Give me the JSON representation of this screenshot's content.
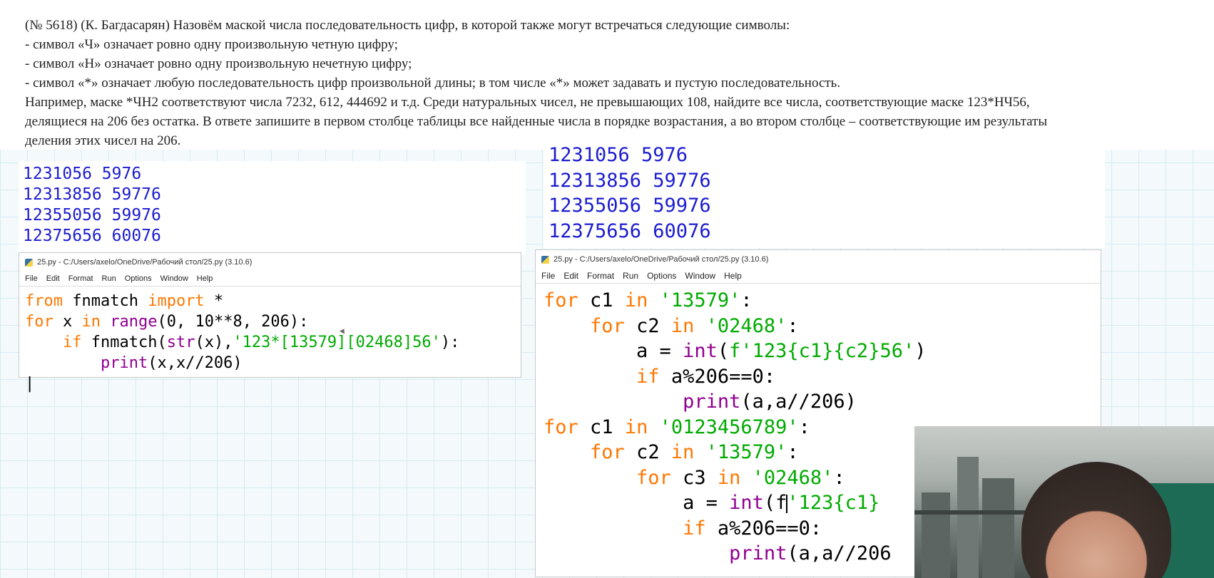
{
  "task": {
    "lines": [
      "(№ 5618) (К. Багдасарян) Назовём маской числа последовательность цифр, в которой также могут встречаться следующие символы:",
      "- символ «Ч» означает ровно одну произвольную четную цифру;",
      "- символ «Н» означает ровно одну произвольную нечетную цифру;",
      "- символ «*» означает любую последовательность цифр произвольной длины; в том числе «*» может задавать и пустую последовательность.",
      "Например, маске *ЧН2 соответствуют числа 7232, 612, 444692 и т.д. Среди натуральных чисел, не превышающих 108, найдите все числа, соответствующие маске 123*НЧ56,",
      "делящиеся на 206 без остатка. В ответе запишите в первом столбце таблицы все найденные числа в порядке возрастания, а во втором столбце – соответствующие им результаты",
      "деления этих чисел на 206."
    ]
  },
  "output_left": [
    "1231056 5976",
    "12313856 59776",
    "12355056 59976",
    "12375656 60076"
  ],
  "output_right": [
    "1231056 5976",
    "12313856 59776",
    "12355056 59976",
    "12375656 60076"
  ],
  "editor_left": {
    "title": "25.py - C:/Users/axelo/OneDrive/Рабочий стол/25.py (3.10.6)",
    "menu": [
      "File",
      "Edit",
      "Format",
      "Run",
      "Options",
      "Window",
      "Help"
    ],
    "code": [
      [
        {
          "t": "from",
          "c": "kw"
        },
        {
          "t": " fnmatch "
        },
        {
          "t": "import",
          "c": "kw"
        },
        {
          "t": " *"
        }
      ],
      [
        {
          "t": "for",
          "c": "kw"
        },
        {
          "t": " x "
        },
        {
          "t": "in",
          "c": "kw"
        },
        {
          "t": " "
        },
        {
          "t": "range",
          "c": "bi"
        },
        {
          "t": "(0, 10**8, 206):"
        }
      ],
      [
        {
          "t": "    "
        },
        {
          "t": "if",
          "c": "kw"
        },
        {
          "t": " fnmatch("
        },
        {
          "t": "str",
          "c": "bi"
        },
        {
          "t": "(x),"
        },
        {
          "t": "'123*[13579][02468]56'",
          "c": "st"
        },
        {
          "t": "):"
        }
      ],
      [
        {
          "t": "        "
        },
        {
          "t": "print",
          "c": "bi"
        },
        {
          "t": "(x,x//206)"
        }
      ],
      [
        {
          "t": "|"
        }
      ]
    ]
  },
  "editor_right": {
    "title": "25.py - C:/Users/axelo/OneDrive/Рабочий стол/25.py (3.10.6)",
    "menu": [
      "File",
      "Edit",
      "Format",
      "Run",
      "Options",
      "Window",
      "Help"
    ],
    "code": [
      [
        {
          "t": "for",
          "c": "kw"
        },
        {
          "t": " c1 "
        },
        {
          "t": "in",
          "c": "kw"
        },
        {
          "t": " "
        },
        {
          "t": "'13579'",
          "c": "st"
        },
        {
          "t": ":"
        }
      ],
      [
        {
          "t": "    "
        },
        {
          "t": "for",
          "c": "kw"
        },
        {
          "t": " c2 "
        },
        {
          "t": "in",
          "c": "kw"
        },
        {
          "t": " "
        },
        {
          "t": "'02468'",
          "c": "st"
        },
        {
          "t": ":"
        }
      ],
      [
        {
          "t": "        a = "
        },
        {
          "t": "int",
          "c": "bi"
        },
        {
          "t": "("
        },
        {
          "t": "f'123{c1}{c2}56'",
          "c": "st"
        },
        {
          "t": ")"
        }
      ],
      [
        {
          "t": "        "
        },
        {
          "t": "if",
          "c": "kw"
        },
        {
          "t": " a%206==0:"
        }
      ],
      [
        {
          "t": "            "
        },
        {
          "t": "print",
          "c": "bi"
        },
        {
          "t": "(a,a//206)"
        }
      ],
      [
        {
          "t": "for",
          "c": "kw"
        },
        {
          "t": " c1 "
        },
        {
          "t": "in",
          "c": "kw"
        },
        {
          "t": " "
        },
        {
          "t": "'0123456789'",
          "c": "st"
        },
        {
          "t": ":"
        }
      ],
      [
        {
          "t": "    "
        },
        {
          "t": "for",
          "c": "kw"
        },
        {
          "t": " c2 "
        },
        {
          "t": "in",
          "c": "kw"
        },
        {
          "t": " "
        },
        {
          "t": "'13579'",
          "c": "st"
        },
        {
          "t": ":"
        }
      ],
      [
        {
          "t": "        "
        },
        {
          "t": "for",
          "c": "kw"
        },
        {
          "t": " c3 "
        },
        {
          "t": "in",
          "c": "kw"
        },
        {
          "t": " "
        },
        {
          "t": "'02468'",
          "c": "st"
        },
        {
          "t": ":"
        }
      ],
      [
        {
          "t": "            a = "
        },
        {
          "t": "int",
          "c": "bi"
        },
        {
          "t": "(f"
        },
        {
          "t": "CURSOR",
          "c": "cursor"
        },
        {
          "t": "'123{c1}",
          "c": "st"
        }
      ],
      [
        {
          "t": "            "
        },
        {
          "t": "if",
          "c": "kw"
        },
        {
          "t": " a%206==0:"
        }
      ],
      [
        {
          "t": "                "
        },
        {
          "t": "print",
          "c": "bi"
        },
        {
          "t": "(a,a//206"
        }
      ]
    ]
  }
}
